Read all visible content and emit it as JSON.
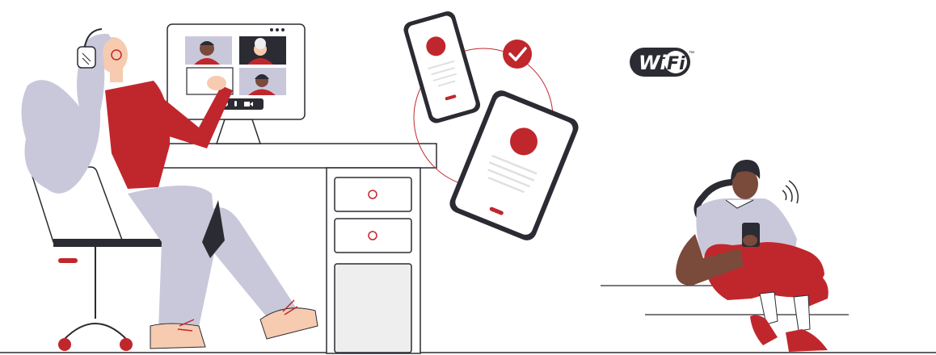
{
  "wifi_logo": {
    "part1": "Wi",
    "part2": "Fi",
    "trademark": "™"
  },
  "video_call": {
    "participants": [
      "participant-man",
      "participant-elder",
      "participant-self",
      "participant-woman"
    ],
    "controls": [
      "phone-icon",
      "microphone-icon",
      "camera-icon"
    ]
  },
  "status": {
    "verified": "check-icon"
  },
  "colors": {
    "accent": "#c0272d",
    "outline": "#2b2b33",
    "lavender": "#c9c8db",
    "skin_dark": "#7a4a3a",
    "skin_light": "#f6cbb0",
    "gray": "#eeeeee"
  }
}
